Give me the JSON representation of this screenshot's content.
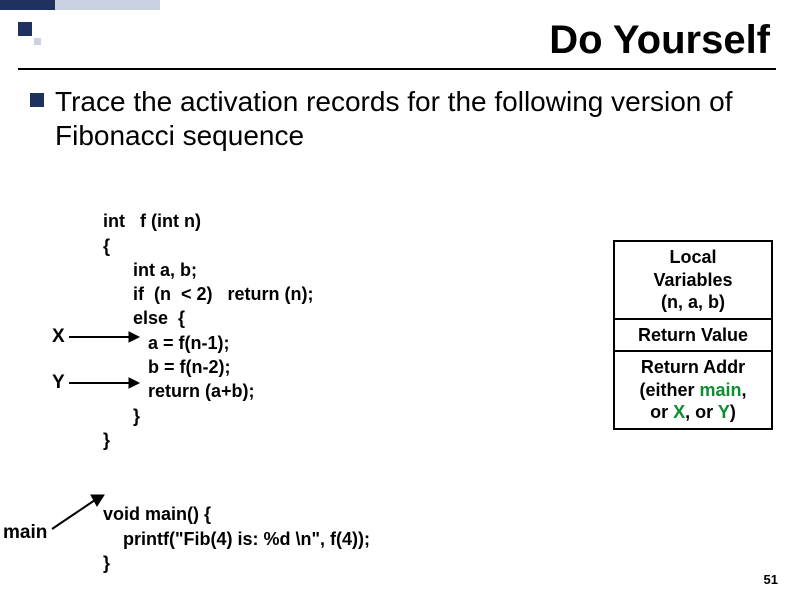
{
  "title": "Do Yourself",
  "mainText": "Trace the activation records for the following version of Fibonacci sequence",
  "code": {
    "line1": "int   f (int n)",
    "line2": "{",
    "line3": "      int a, b;",
    "line4": "      if  (n  < 2)   return (n);",
    "line5": "      else  {",
    "line6": "         a = f(n-1);",
    "line7": "         b = f(n-2);",
    "line8": "         return (a+b);",
    "line9": "      }",
    "line10": "}"
  },
  "mainCode": {
    "line1": "void main() {",
    "line2": "    printf(\"Fib(4) is: %d \\n\", f(4));",
    "line3": "}"
  },
  "labels": {
    "x": "X",
    "y": "Y",
    "main": "main"
  },
  "stack": {
    "cell1a": "Local",
    "cell1b": "Variables",
    "cell1c": "(n, a, b)",
    "cell2": "Return Value",
    "cell3a": "Return Addr",
    "cell3b_pre": "(either ",
    "cell3b_main": "main",
    "cell3b_post": ",",
    "cell3c_pre": "or ",
    "cell3c_x": "X",
    "cell3c_mid": ", or ",
    "cell3c_y": "Y",
    "cell3c_post": ")"
  },
  "pageNum": "51"
}
